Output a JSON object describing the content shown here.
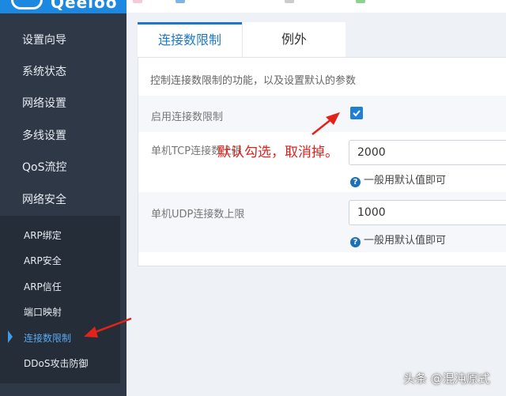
{
  "sidebar": {
    "logo_text": "Qeeloo",
    "items": [
      {
        "label": "设置向导"
      },
      {
        "label": "系统状态"
      },
      {
        "label": "网络设置"
      },
      {
        "label": "多线设置"
      },
      {
        "label": "QoS流控"
      },
      {
        "label": "网络安全"
      }
    ],
    "submenu": [
      {
        "label": "ARP绑定"
      },
      {
        "label": "ARP安全"
      },
      {
        "label": "ARP信任"
      },
      {
        "label": "端口映射"
      },
      {
        "label": "连接数限制"
      },
      {
        "label": "DDoS攻击防御"
      }
    ],
    "active_submenu": "连接数限制"
  },
  "tabs": [
    {
      "label": "连接数限制",
      "active": true
    },
    {
      "label": "例外",
      "active": false
    }
  ],
  "panel": {
    "description": "控制连接数限制的功能，以及设置默认的参数",
    "enable_label": "启用连接数限制",
    "enable_checked": true,
    "tcp_label": "单机TCP连接数上限",
    "tcp_value": "2000",
    "tcp_hint": "一般用默认值即可",
    "udp_label": "单机UDP连接数上限",
    "udp_value": "1000",
    "udp_hint": "一般用默认值即可"
  },
  "annotation": "默认勾选，取消掉。",
  "watermark": "头条 @混沌原式",
  "colors": {
    "sidebar_bg": "#2e3847",
    "accent": "#1e78c8",
    "annotation": "#d9231c"
  }
}
